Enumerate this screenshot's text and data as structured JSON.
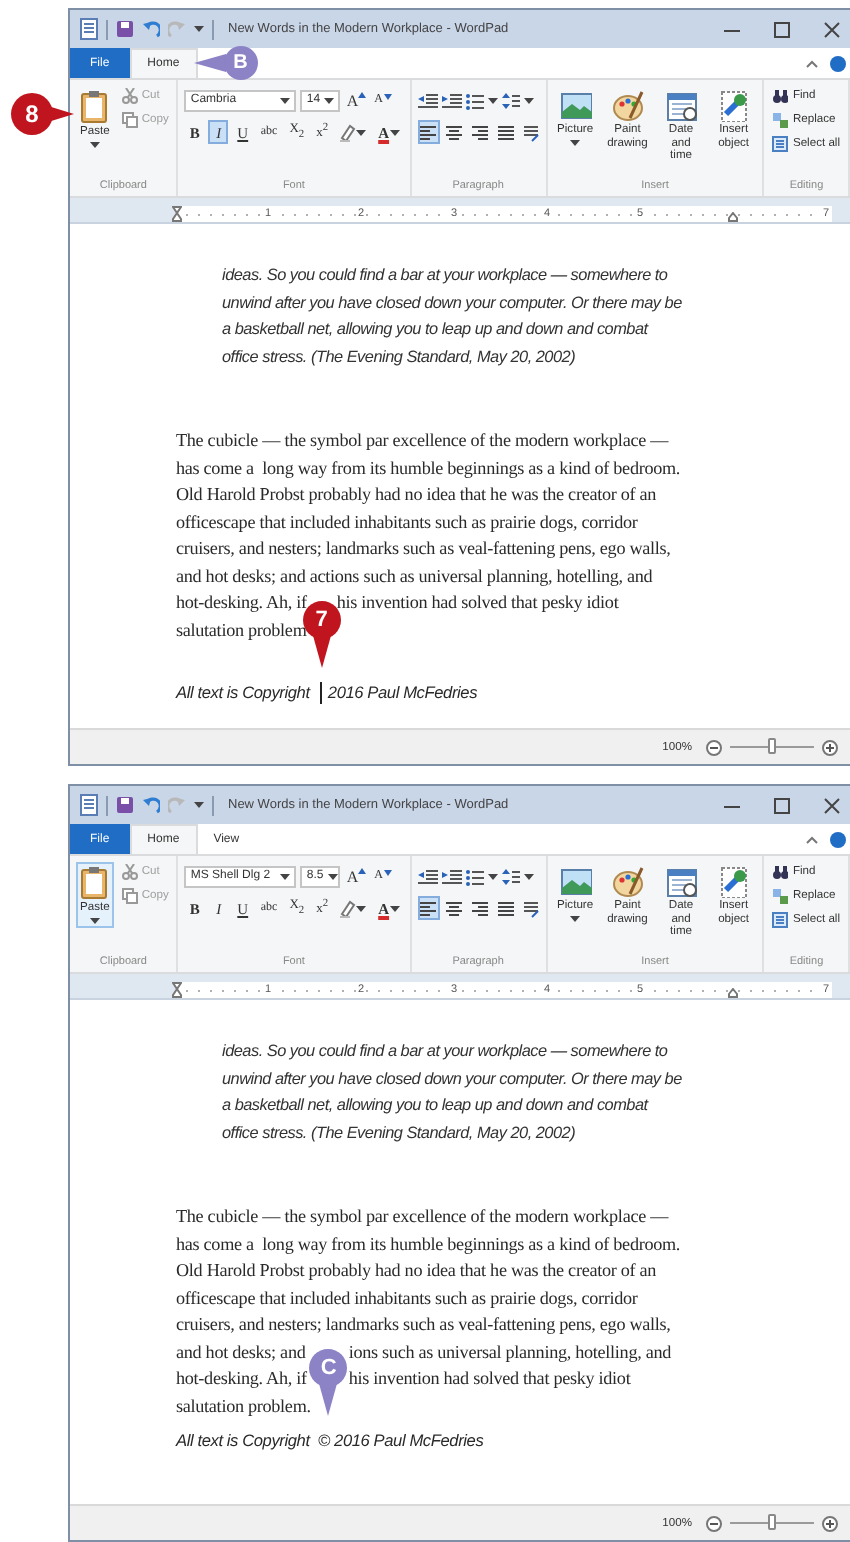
{
  "windows": [
    {
      "title": "New Words in the Modern Workplace - WordPad",
      "tabs": [
        {
          "label": "File",
          "kind": "file",
          "selected": false
        },
        {
          "label": "Home",
          "kind": "tab",
          "selected": true
        }
      ],
      "clipboard": {
        "label": "Clipboard",
        "paste": {
          "label": "Paste",
          "selected": false
        },
        "cut": {
          "label": "Cut",
          "disabled": true
        },
        "copy": {
          "label": "Copy",
          "disabled": true
        }
      },
      "font": {
        "label": "Font",
        "family": "Cambria",
        "size": "14",
        "resize": [
          "A",
          "A"
        ],
        "format": [
          {
            "kind": "bold",
            "label": "B",
            "selected": false
          },
          {
            "kind": "italic",
            "label": "I",
            "selected": true
          },
          {
            "kind": "underline",
            "label": "U",
            "selected": false
          },
          {
            "kind": "strike",
            "label": "abc",
            "selected": false
          },
          {
            "kind": "sub",
            "label": "X$_{2}$",
            "selected": false
          },
          {
            "kind": "sup",
            "label": "x$^{2}$",
            "selected": false
          },
          {
            "kind": "highlight",
            "selected": false
          },
          {
            "kind": "color",
            "label": "A",
            "selected": false
          }
        ]
      },
      "paragraph": {
        "label": "Paragraph",
        "alignment": [
          {
            "selected": true
          },
          {
            "selected": false
          },
          {
            "selected": false
          },
          {
            "selected": false
          }
        ]
      },
      "insert": {
        "label": "Insert",
        "items": [
          "Picture",
          "Paint drawing",
          "Date and time",
          "Insert object"
        ]
      },
      "editing": {
        "label": "Editing",
        "items": [
          "Find",
          "Replace",
          "Select all"
        ]
      },
      "ruler": [
        "1",
        "2",
        "3",
        "4",
        "5",
        "7"
      ],
      "document": [
        {
          "kind": "quote",
          "lines": [
            {
              "text": [
                "ideas. So you could find a bar at your workplace — somewhere to"
              ]
            },
            {
              "text": [
                "unwind after you have closed down your computer. Or there may be"
              ]
            },
            {
              "text": [
                "a basketball net, allowing you to leap up and down and combat"
              ]
            },
            {
              "text": [
                "office stress. (The Evening Standard, May 20, 2002)"
              ]
            }
          ]
        },
        {
          "kind": "body",
          "lines": [
            {
              "text": [
                "The cubicle — the symbol par excellence of the modern workplace —"
              ]
            },
            {
              "text": [
                "has come a  long way from its humble beginnings as a kind of bedroom."
              ]
            },
            {
              "text": [
                "Old Harold Probst probably had no idea that he was the creator of an"
              ]
            },
            {
              "text": [
                "officescape that included inhabitants such as prairie dogs, corridor"
              ]
            },
            {
              "text": [
                "cruisers, and nesters; landmarks such as veal-fattening pens, ego walls,"
              ]
            },
            {
              "text": [
                "and hot desks; and actions such as universal planning, hotelling, and"
              ]
            },
            {
              "text": [
                "hot-desking. Ah, if",
                "his invention had solved that pesky idiot"
              ]
            },
            {
              "text": [
                "salutation problem"
              ]
            }
          ]
        },
        {
          "kind": "blank"
        },
        {
          "kind": "signature",
          "cursor": true,
          "lines": [
            {
              "text": [
                "All text is Copyright ",
                "2016 Paul McFedries"
              ]
            }
          ]
        }
      ],
      "status": {
        "zoom": "100%",
        "level": 0.5
      },
      "callouts": [
        {
          "label": "8",
          "kind": "paste",
          "color": "#c0151e"
        },
        {
          "label": "B",
          "kind": "tab",
          "color": "#8c82c6"
        },
        {
          "label": "7",
          "kind": "pin",
          "color": "#c0151e"
        }
      ]
    },
    {
      "title": "New Words in the Modern Workplace - WordPad",
      "tabs": [
        {
          "label": "File",
          "kind": "file",
          "selected": false
        },
        {
          "label": "Home",
          "kind": "tab",
          "selected": true
        },
        {
          "label": "View",
          "kind": "tab",
          "selected": false
        }
      ],
      "clipboard": {
        "label": "Clipboard",
        "paste": {
          "label": "Paste",
          "selected": true
        },
        "cut": {
          "label": "Cut",
          "disabled": true
        },
        "copy": {
          "label": "Copy",
          "disabled": true
        }
      },
      "font": {
        "label": "Font",
        "family": "MS Shell Dlg 2",
        "size": "8.5",
        "resize": [
          "A",
          "A"
        ],
        "format": [
          {
            "kind": "bold",
            "label": "B",
            "selected": false
          },
          {
            "kind": "italic",
            "label": "I",
            "selected": false
          },
          {
            "kind": "underline",
            "label": "U",
            "selected": false
          },
          {
            "kind": "strike",
            "label": "abc",
            "selected": false
          },
          {
            "kind": "sub",
            "label": "X$_{2}$",
            "selected": false
          },
          {
            "kind": "sup",
            "label": "x$^{2}$",
            "selected": false
          },
          {
            "kind": "highlight",
            "selected": false
          },
          {
            "kind": "color",
            "label": "A",
            "selected": false
          }
        ]
      },
      "paragraph": {
        "label": "Paragraph",
        "alignment": [
          {
            "selected": true
          },
          {
            "selected": false
          },
          {
            "selected": false
          },
          {
            "selected": false
          }
        ]
      },
      "insert": {
        "label": "Insert",
        "items": [
          "Picture",
          "Paint drawing",
          "Date and time",
          "Insert object"
        ]
      },
      "editing": {
        "label": "Editing",
        "items": [
          "Find",
          "Replace",
          "Select all"
        ]
      },
      "ruler": [
        "1",
        "2",
        "3",
        "4",
        "5",
        "7"
      ],
      "document": [
        {
          "kind": "quote",
          "lines": [
            {
              "text": [
                "ideas. So you could find a bar at your workplace — somewhere to"
              ]
            },
            {
              "text": [
                "unwind after you have closed down your computer. Or there may be"
              ]
            },
            {
              "text": [
                "a basketball net, allowing you to leap up and down and combat"
              ]
            },
            {
              "text": [
                "office stress. (The Evening Standard, May 20, 2002)"
              ]
            }
          ]
        },
        {
          "kind": "body",
          "lines": [
            {
              "text": [
                "The cubicle — the symbol par excellence of the modern workplace —"
              ]
            },
            {
              "text": [
                "has come a  long way from its humble beginnings as a kind of bedroom."
              ]
            },
            {
              "text": [
                "Old Harold Probst probably had no idea that he was the creator of an"
              ]
            },
            {
              "text": [
                "officescape that included inhabitants such as prairie dogs, corridor"
              ]
            },
            {
              "text": [
                "cruisers, and nesters; landmarks such as veal-fattening pens, ego walls,"
              ]
            },
            {
              "text": [
                "and hot desks; and",
                "ions such as universal planning, hotelling, and"
              ]
            },
            {
              "text": [
                "hot-desking. Ah, if",
                "his invention had solved that pesky idiot"
              ]
            },
            {
              "text": [
                "salutation problem."
              ]
            }
          ]
        },
        {
          "kind": "signature",
          "lines": [
            {
              "text": [
                "All text is Copyright  © 2016 Paul McFedries"
              ]
            }
          ]
        }
      ],
      "status": {
        "zoom": "100%",
        "level": 0.5
      },
      "callouts": [
        {
          "label": "C",
          "kind": "pin",
          "color": "#8c82c6"
        }
      ]
    }
  ]
}
